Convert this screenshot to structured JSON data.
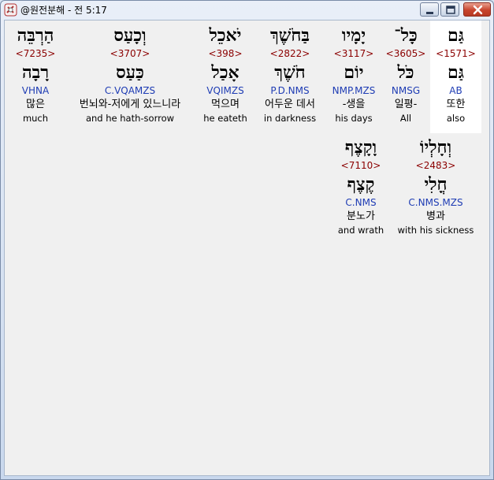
{
  "window": {
    "title": "@원전분해 - 전 5:17",
    "icon": "app-icon",
    "controls": [
      "minimize-icon",
      "maximize-icon",
      "close-icon"
    ]
  },
  "colors": {
    "strongs": "#8b0000",
    "morph": "#1e3cb4",
    "highlight": "#ffffff"
  },
  "words": [
    {
      "hebrew": "גַּם",
      "strongs": "<1571>",
      "lemma": "גַּם",
      "morph": "AB",
      "korean": "또한",
      "english": "also",
      "selected": true
    },
    {
      "hebrew": "כָּל־",
      "strongs": "<3605>",
      "lemma": "כֹּל",
      "morph": "NMSG",
      "korean": "일평-",
      "english": "All",
      "selected": false
    },
    {
      "hebrew": "יָמָיו",
      "strongs": "<3117>",
      "lemma": "יוֹם",
      "morph": "NMP.MZS",
      "korean": "-생을",
      "english": "his days",
      "selected": false
    },
    {
      "hebrew": "בַּחֹשֶׁךְ",
      "strongs": "<2822>",
      "lemma": "חֹשֶׁךְ",
      "morph": "P.D.NMS",
      "korean": "어두운 데서",
      "english": "in darkness",
      "selected": false
    },
    {
      "hebrew": "יֹאכֵל",
      "strongs": "<398>",
      "lemma": "אָכַל",
      "morph": "VQIMZS",
      "korean": "먹으며",
      "english": "he eateth",
      "selected": false
    },
    {
      "hebrew": "וְכָעַס",
      "strongs": "<3707>",
      "lemma": "כַּעַס",
      "morph": "C.VQAMZS",
      "korean": "번뇌와-저에게 있느니라",
      "english": "and he hath-sorrow",
      "selected": false
    },
    {
      "hebrew": "הַרְבֵּה",
      "strongs": "<7235>",
      "lemma": "רָבָה",
      "morph": "VHNA",
      "korean": "많은",
      "english": "much",
      "selected": false
    },
    {
      "hebrew": "וְחָלְיוֹ",
      "strongs": "<2483>",
      "lemma": "חֳלִי",
      "morph": "C.NMS.MZS",
      "korean": "병과",
      "english": "with his sickness",
      "selected": false
    },
    {
      "hebrew": "וָקָצֶף",
      "strongs": "<7110>",
      "lemma": "קֶצֶף",
      "morph": "C.NMS",
      "korean": "분노가",
      "english": "and wrath",
      "selected": false
    }
  ]
}
